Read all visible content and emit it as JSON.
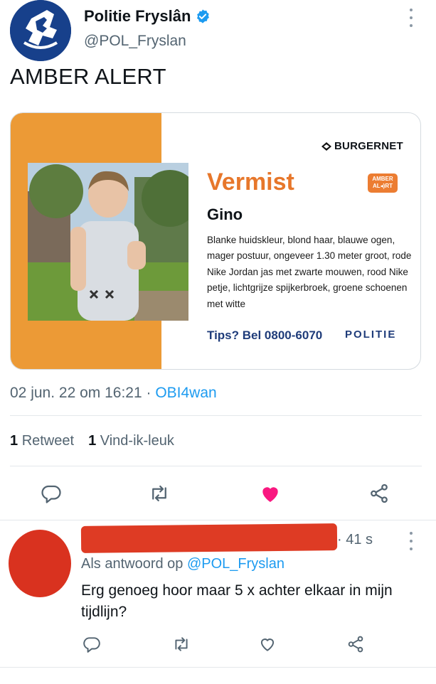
{
  "tweet": {
    "display_name": "Politie Fryslân",
    "handle": "@POL_Fryslan",
    "text": "AMBER ALERT",
    "timestamp": "02 jun. 22 om 16:21",
    "separator": "·",
    "source": "OBI4wan",
    "retweet_count": "1",
    "retweet_label": "Retweet",
    "like_count": "1",
    "like_label": "Vind-ik-leuk",
    "liked": true,
    "colors": {
      "accent": "#1d9bf0",
      "like": "#f91880",
      "muted": "#536471"
    }
  },
  "card": {
    "brand": "BURGERNET",
    "heading": "Vermist",
    "badge_line1": "AMBER",
    "badge_line2": "AL◂)RT",
    "name": "Gino",
    "description": "Blanke huidskleur, blond haar, blauwe ogen, mager postuur, ongeveer 1.30 meter groot, rode Nike Jordan jas met zwarte mouwen, rood Nike petje, lichtgrijze spijkerbroek, groene schoenen met witte",
    "tips": "Tips? Bel 0800-6070",
    "politie": "POLITIE",
    "colors": {
      "orange": "#ec9a36",
      "heading": "#e7772b",
      "navy": "#1f3c7a"
    }
  },
  "actions": {
    "icons": [
      "reply-icon",
      "retweet-icon",
      "like-icon",
      "share-icon"
    ]
  },
  "reply": {
    "time": "· 41 s",
    "reply_prefix": "Als antwoord op",
    "reply_mention": "@POL_Fryslan",
    "text": "Erg genoeg hoor maar 5 x achter elkaar in mijn tijdlijn?",
    "icons": [
      "reply-icon",
      "retweet-icon",
      "like-icon",
      "share-icon"
    ]
  }
}
